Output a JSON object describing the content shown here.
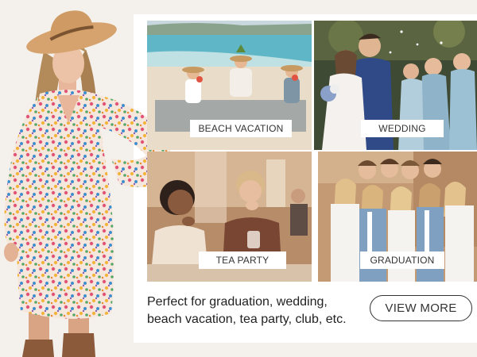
{
  "occasions": [
    {
      "label": "BEACH VACATION"
    },
    {
      "label": "WEDDING"
    },
    {
      "label": "TEA PARTY"
    },
    {
      "label": "GRADUATION"
    }
  ],
  "caption": {
    "line1": "Perfect for graduation, wedding,",
    "line2": "beach vacation, tea party, club, etc."
  },
  "cta": {
    "label": "VIEW MORE"
  }
}
